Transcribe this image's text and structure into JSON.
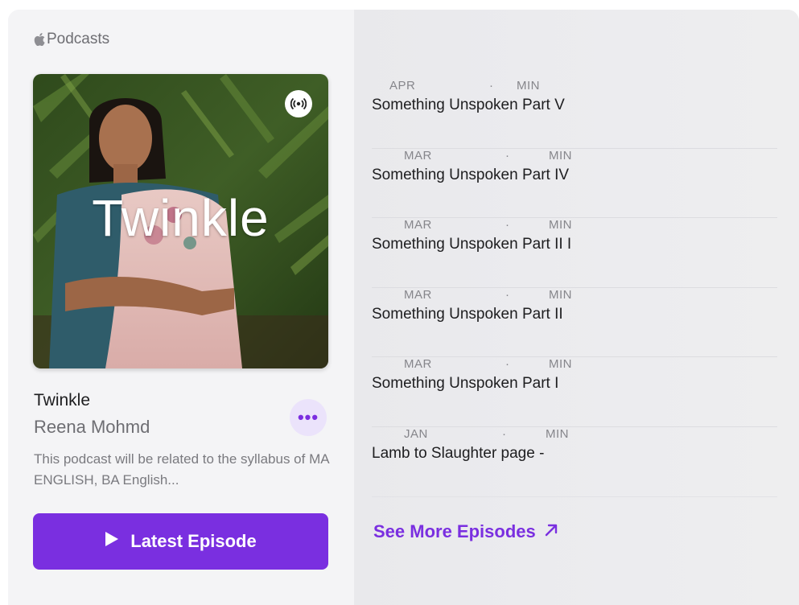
{
  "app": {
    "name": "Podcasts"
  },
  "show": {
    "artwork_title": "Twinkle",
    "title": "Twinkle",
    "author": "Reena Mohmd",
    "description": "This podcast will be related to the syllabus of MA ENGLISH, BA English...",
    "more_label": "•••",
    "latest_label": "Latest Episode"
  },
  "episodes": [
    {
      "month": "APR",
      "sep": "·",
      "unit": "MIN",
      "title": "Something Unspoken Part V"
    },
    {
      "month": "MAR",
      "sep": "·",
      "unit": "MIN",
      "title": "Something Unspoken Part IV"
    },
    {
      "month": "MAR",
      "sep": "·",
      "unit": "MIN",
      "title": "Something Unspoken Part II I"
    },
    {
      "month": "MAR",
      "sep": "·",
      "unit": "MIN",
      "title": "Something Unspoken Part II"
    },
    {
      "month": "MAR",
      "sep": "·",
      "unit": "MIN",
      "title": "Something Unspoken Part I"
    },
    {
      "month": "JAN",
      "sep": "·",
      "unit": "MIN",
      "title": "Lamb to Slaughter page        -"
    }
  ],
  "see_more_label": "See More Episodes",
  "icons": {
    "brand": "apple-logo-icon",
    "badge": "podcast-broadcast-icon",
    "play": "play-icon",
    "external": "arrow-up-right-icon"
  },
  "colors": {
    "accent": "#7a2fe0",
    "accent_soft": "#ebe3fb",
    "text_primary": "#1d1d1f",
    "text_secondary": "#6e6e73"
  }
}
